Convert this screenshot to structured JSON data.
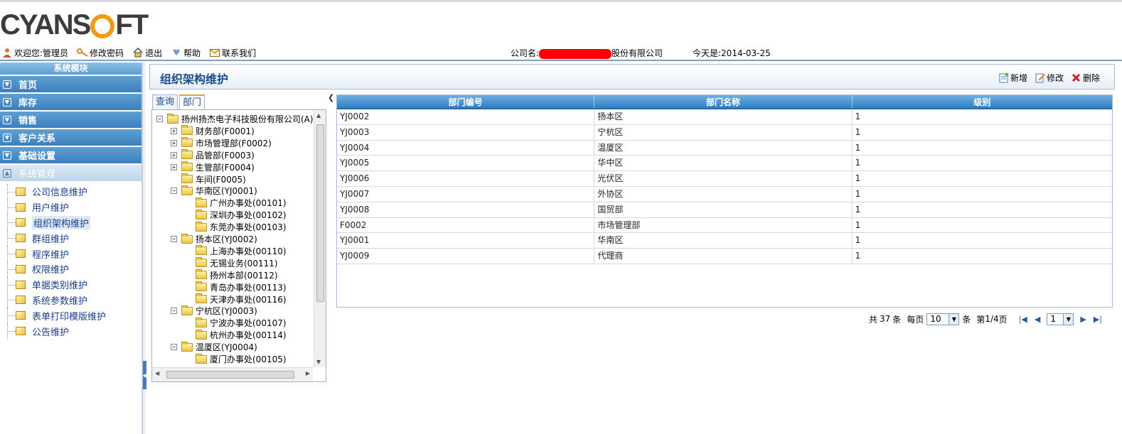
{
  "brand": {
    "logo_text_a": "CYANS",
    "logo_text_b": "FT"
  },
  "toolbar": {
    "welcome": "欢迎您:管理员",
    "change_password": "修改密码",
    "logout": "退出",
    "help": "帮助",
    "contact": "联系我们",
    "company_prefix": "公司名:",
    "company_suffix": "股份有限公司",
    "today": "今天是:2014-03-25"
  },
  "sidebar": {
    "title": "系统模块",
    "groups": [
      {
        "label": "首页"
      },
      {
        "label": "库存"
      },
      {
        "label": "销售"
      },
      {
        "label": "客户关系"
      },
      {
        "label": "基础设置"
      },
      {
        "label": "系统管理"
      }
    ],
    "items": [
      {
        "label": "公司信息维护"
      },
      {
        "label": "用户维护"
      },
      {
        "label": "组织架构维护"
      },
      {
        "label": "群组维护"
      },
      {
        "label": "程序维护"
      },
      {
        "label": "权限维护"
      },
      {
        "label": "单据类别维护"
      },
      {
        "label": "系统参数维护"
      },
      {
        "label": "表单打印模版维护"
      },
      {
        "label": "公告维护"
      }
    ]
  },
  "main": {
    "title": "组织架构维护",
    "actions": {
      "add": "新增",
      "edit": "修改",
      "delete": "删除"
    },
    "tabs": [
      {
        "label": "查询"
      },
      {
        "label": "部门"
      }
    ]
  },
  "tree": [
    {
      "label": "扬州扬杰电子科技股份有限公司(A)",
      "expander": "−"
    },
    {
      "label": "财务部(F0001)",
      "expander": "+"
    },
    {
      "label": "市场管理部(F0002)",
      "expander": "+"
    },
    {
      "label": "品管部(F0003)",
      "expander": "+"
    },
    {
      "label": "生管部(F0004)",
      "expander": "+"
    },
    {
      "label": "车间(F0005)",
      "expander": ""
    },
    {
      "label": "华南区(YJ0001)",
      "expander": "−"
    },
    {
      "label": "广州办事处(00101)",
      "expander": ""
    },
    {
      "label": "深圳办事处(00102)",
      "expander": ""
    },
    {
      "label": "东莞办事处(00103)",
      "expander": ""
    },
    {
      "label": "扬本区(YJ0002)",
      "expander": "−"
    },
    {
      "label": "上海办事处(00110)",
      "expander": ""
    },
    {
      "label": "无锡业务(00111)",
      "expander": ""
    },
    {
      "label": "扬州本部(00112)",
      "expander": ""
    },
    {
      "label": "青岛办事处(00113)",
      "expander": ""
    },
    {
      "label": "天津办事处(00116)",
      "expander": ""
    },
    {
      "label": "宁杭区(YJ0003)",
      "expander": "−"
    },
    {
      "label": "宁波办事处(00107)",
      "expander": ""
    },
    {
      "label": "杭州办事处(00114)",
      "expander": ""
    },
    {
      "label": "温厦区(YJ0004)",
      "expander": "−"
    },
    {
      "label": "厦门办事处(00105)",
      "expander": ""
    }
  ],
  "grid": {
    "headers": [
      "部门编号",
      "部门名称",
      "级别"
    ],
    "rows": [
      [
        "YJ0002",
        "扬本区",
        "1"
      ],
      [
        "YJ0003",
        "宁杭区",
        "1"
      ],
      [
        "YJ0004",
        "温厦区",
        "1"
      ],
      [
        "YJ0005",
        "华中区",
        "1"
      ],
      [
        "YJ0006",
        "光伏区",
        "1"
      ],
      [
        "YJ0007",
        "外协区",
        "1"
      ],
      [
        "YJ0008",
        "国贸部",
        "1"
      ],
      [
        "F0002",
        "市场管理部",
        "1"
      ],
      [
        "YJ0001",
        "华南区",
        "1"
      ],
      [
        "YJ0009",
        "代理商",
        "1"
      ]
    ]
  },
  "pager": {
    "total_prefix": "共",
    "total": "37",
    "total_unit": "条",
    "per_page_label": "每页",
    "per_page": "10",
    "per_page_unit": "条",
    "page_prefix": "第",
    "page_info": "1/4",
    "page_unit": "页",
    "current_page": "1"
  }
}
